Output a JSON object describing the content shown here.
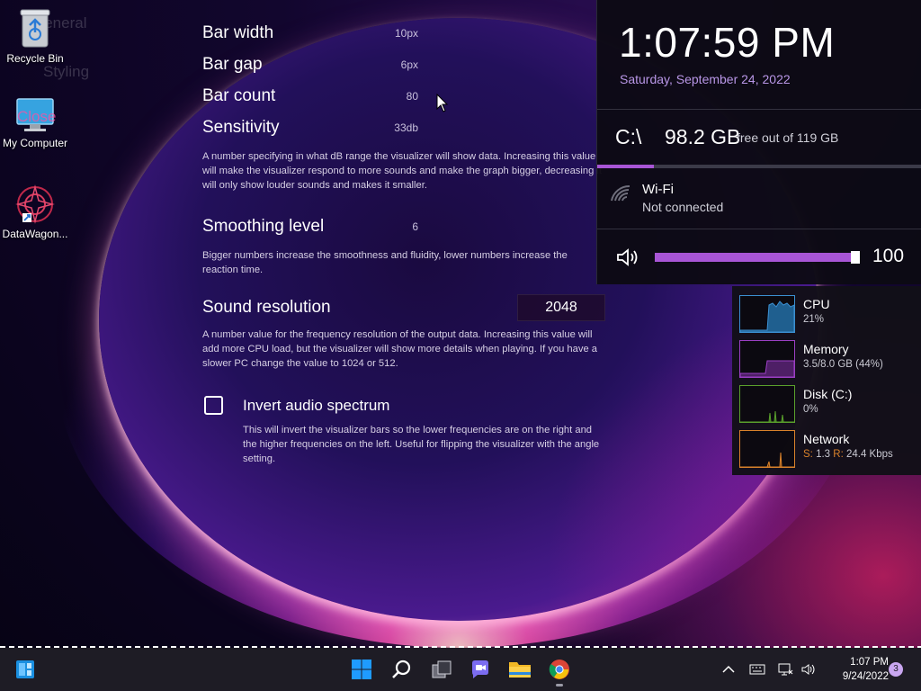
{
  "desktop": {
    "icons": [
      {
        "label": "Recycle Bin"
      },
      {
        "label": "My Computer"
      },
      {
        "label": "DataWagon..."
      }
    ],
    "ghost_texts": [
      "General",
      "Styling",
      "Close"
    ]
  },
  "settings": {
    "bar_width": {
      "label": "Bar width",
      "value": "10px"
    },
    "bar_gap": {
      "label": "Bar gap",
      "value": "6px"
    },
    "bar_count": {
      "label": "Bar count",
      "value": "80"
    },
    "sensitivity": {
      "label": "Sensitivity",
      "value": "33db",
      "description": "A number specifying in what dB range the visualizer will show data. Increasing this value will make the visualizer respond to more sounds and make the graph bigger, decreasing it will only show louder sounds and makes it smaller."
    },
    "smoothing": {
      "label": "Smoothing level",
      "value": "6",
      "description": "Bigger numbers increase the smoothness and fluidity, lower numbers increase the reaction time."
    },
    "resolution": {
      "label": "Sound resolution",
      "value": "2048",
      "description": "A number value for the frequency resolution of the output data. Increasing this value will add more CPU load, but the visualizer will show more details when playing. If you have a slower PC change the value to 1024 or 512."
    },
    "invert": {
      "label": "Invert audio spectrum",
      "checked": false,
      "description": "This will invert the visualizer bars so the lower frequencies are on the right and the higher frequencies on the left. Useful for flipping the visualizer with the angle setting."
    }
  },
  "flyout": {
    "time": "1:07:59 PM",
    "date": "Saturday, September 24, 2022",
    "drive": {
      "letter": "C:\\",
      "free": "98.2 GB",
      "total_text": "free out of 119 GB",
      "used_fraction": 0.175
    },
    "wifi": {
      "title": "Wi-Fi",
      "status": "Not connected"
    },
    "volume": {
      "value": "100",
      "level": 1.0
    },
    "accent_color": "#a855d6"
  },
  "performance": {
    "cpu": {
      "name": "CPU",
      "value": "21%",
      "color": "#3b8fd1"
    },
    "memory": {
      "name": "Memory",
      "value": "3.5/8.0 GB (44%)",
      "color": "#9b3fc4"
    },
    "disk": {
      "name": "Disk (C:)",
      "value": "0%",
      "color": "#5aa02c"
    },
    "network": {
      "name": "Network",
      "send_label": "S:",
      "send": "1.3",
      "recv_label": "R:",
      "recv": "24.4 Kbps",
      "color": "#d9822b"
    }
  },
  "taskbar": {
    "apps": [
      "widgets-icon",
      "start-icon",
      "search-icon",
      "task-view-icon",
      "chat-icon",
      "file-explorer-icon",
      "chrome-icon"
    ],
    "tray_time": "1:07 PM",
    "tray_date": "9/24/2022",
    "notifications": "3"
  }
}
